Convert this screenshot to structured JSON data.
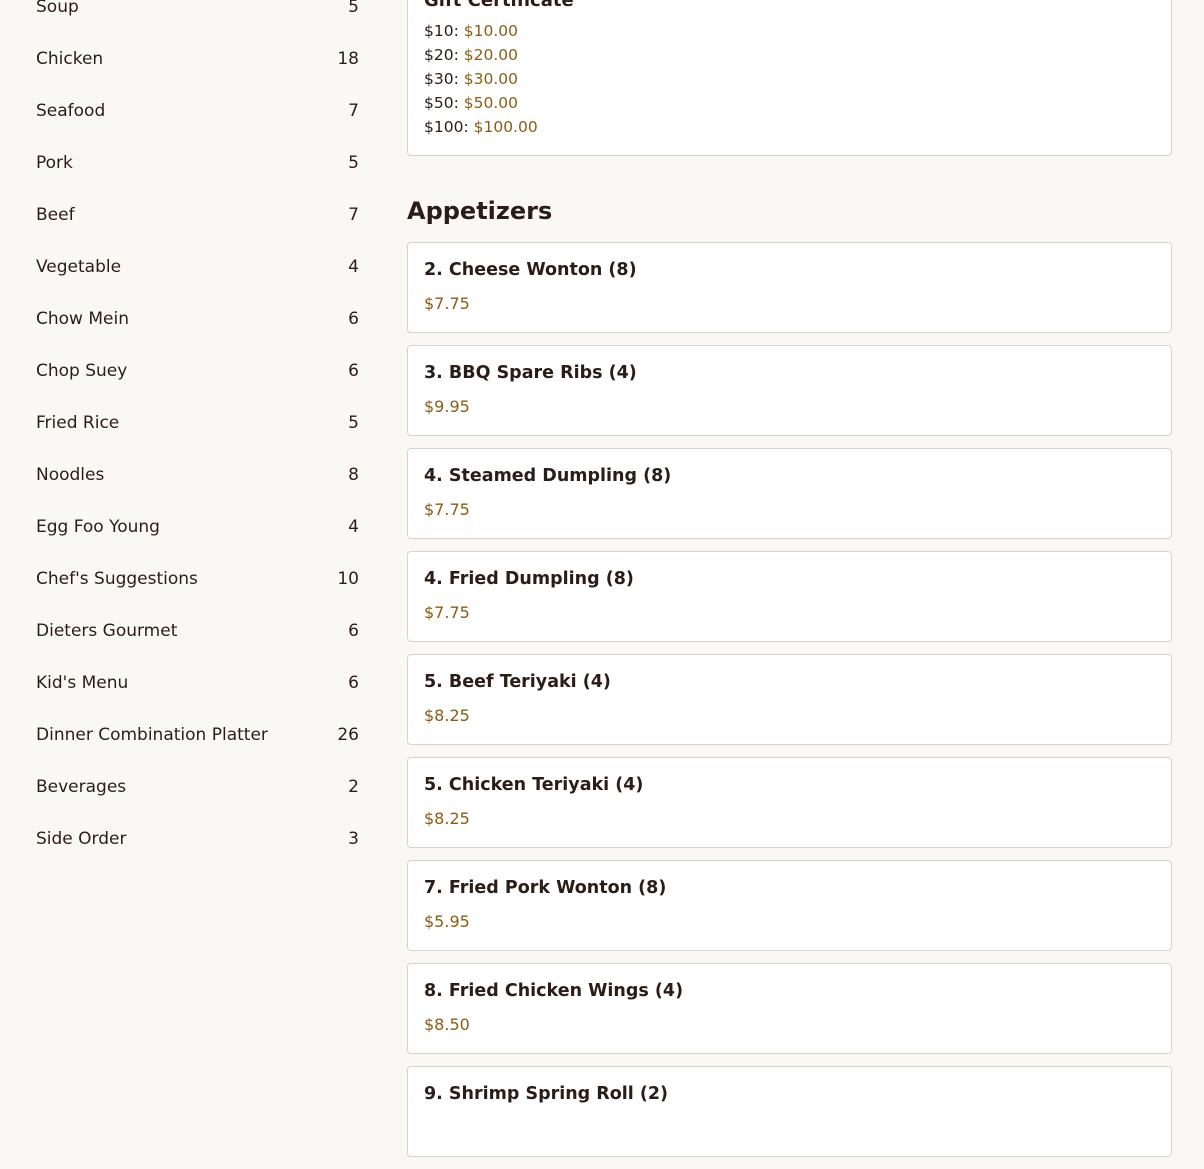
{
  "sidebar": {
    "categories": [
      {
        "name": "Soup",
        "count": "5"
      },
      {
        "name": "Chicken",
        "count": "18"
      },
      {
        "name": "Seafood",
        "count": "7"
      },
      {
        "name": "Pork",
        "count": "5"
      },
      {
        "name": "Beef",
        "count": "7"
      },
      {
        "name": "Vegetable",
        "count": "4"
      },
      {
        "name": "Chow Mein",
        "count": "6"
      },
      {
        "name": "Chop Suey",
        "count": "6"
      },
      {
        "name": "Fried Rice",
        "count": "5"
      },
      {
        "name": "Noodles",
        "count": "8"
      },
      {
        "name": "Egg Foo Young",
        "count": "4"
      },
      {
        "name": "Chef's Suggestions",
        "count": "10"
      },
      {
        "name": "Dieters Gourmet",
        "count": "6"
      },
      {
        "name": "Kid's Menu",
        "count": "6"
      },
      {
        "name": "Dinner Combination Platter",
        "count": "26"
      },
      {
        "name": "Beverages",
        "count": "2"
      },
      {
        "name": "Side Order",
        "count": "3"
      }
    ]
  },
  "gift_certificate": {
    "title": "Gift Certificate",
    "options": [
      {
        "label": "$10:",
        "price": "$10.00"
      },
      {
        "label": "$20:",
        "price": "$20.00"
      },
      {
        "label": "$30:",
        "price": "$30.00"
      },
      {
        "label": "$50:",
        "price": "$50.00"
      },
      {
        "label": "$100:",
        "price": "$100.00"
      }
    ]
  },
  "appetizers": {
    "title": "Appetizers",
    "items": [
      {
        "name": "2. Cheese Wonton (8)",
        "price": "$7.75"
      },
      {
        "name": "3. BBQ Spare Ribs (4)",
        "price": "$9.95"
      },
      {
        "name": "4. Steamed Dumpling (8)",
        "price": "$7.75"
      },
      {
        "name": "4. Fried Dumpling (8)",
        "price": "$7.75"
      },
      {
        "name": "5. Beef Teriyaki (4)",
        "price": "$8.25"
      },
      {
        "name": "5. Chicken Teriyaki (4)",
        "price": "$8.25"
      },
      {
        "name": "7. Fried Pork Wonton (8)",
        "price": "$5.95"
      },
      {
        "name": "8. Fried Chicken Wings (4)",
        "price": "$8.50"
      },
      {
        "name": "9. Shrimp Spring Roll (2)",
        "price": ""
      }
    ]
  },
  "colors": {
    "background": "#faf8f5",
    "card_background": "#ffffff",
    "card_border": "#d8d2cc",
    "text": "#2b1d16",
    "price": "#8a5d14"
  }
}
